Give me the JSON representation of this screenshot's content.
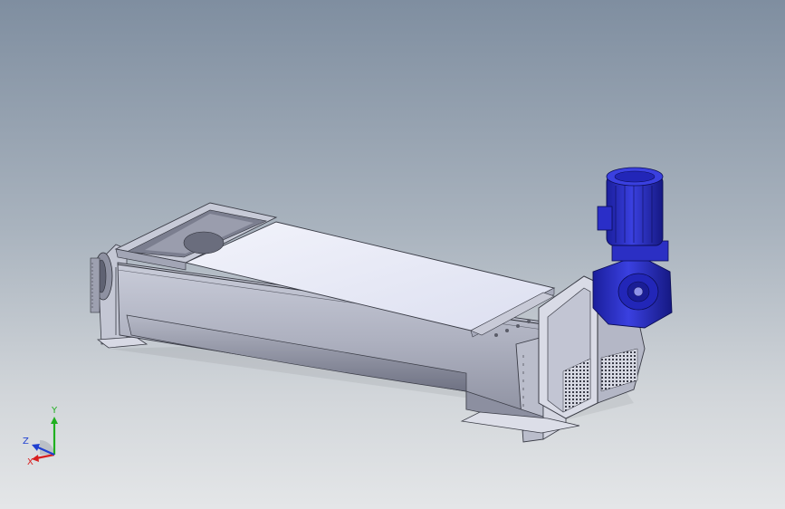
{
  "viewport": {
    "background_top": "#7f8ea0",
    "background_bottom": "#e4e6e8",
    "model": "screw-conveyor-assembly"
  },
  "triad": {
    "x_label": "X",
    "y_label": "Y",
    "z_label": "Z",
    "x_color": "#d82020",
    "y_color": "#20b020",
    "z_color": "#2040d0"
  },
  "colors": {
    "steel_light": "#e6e8f4",
    "steel_mid": "#b9bccb",
    "steel_dark": "#7c7f90",
    "edge": "#3a3c46",
    "motor_blue": "#2a2ec8",
    "motor_dark": "#12157a"
  }
}
